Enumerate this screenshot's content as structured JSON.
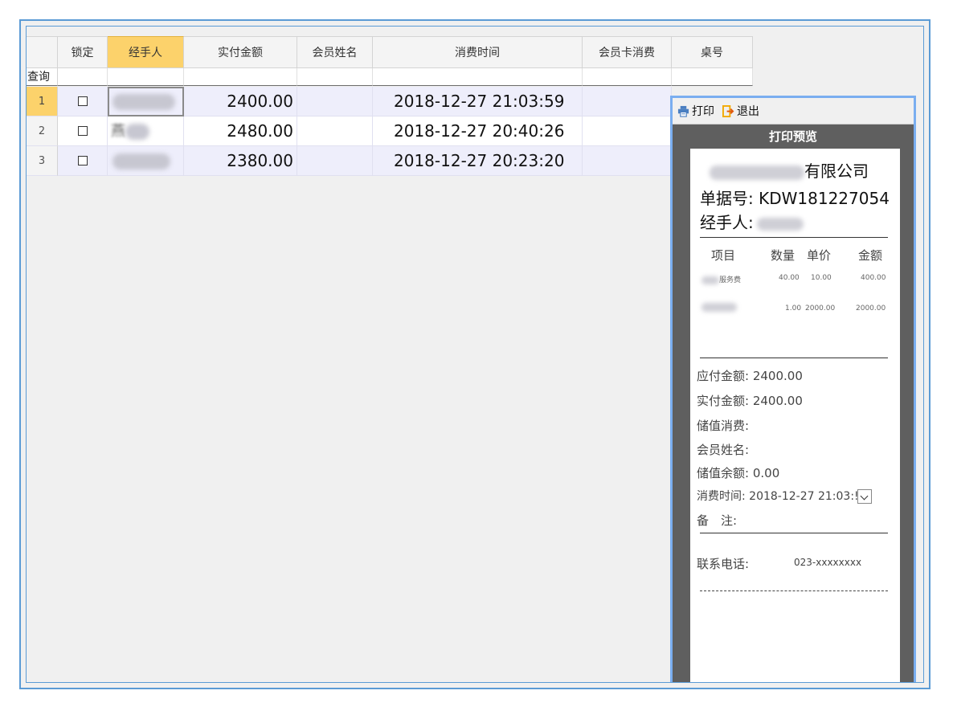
{
  "grid": {
    "columns": [
      {
        "key": "rownum",
        "label": ""
      },
      {
        "key": "lock",
        "label": "锁定"
      },
      {
        "key": "handler",
        "label": "经手人"
      },
      {
        "key": "paid",
        "label": "实付金额"
      },
      {
        "key": "member",
        "label": "会员姓名"
      },
      {
        "key": "time",
        "label": "消费时间"
      },
      {
        "key": "card",
        "label": "会员卡消费"
      },
      {
        "key": "table",
        "label": "桌号"
      }
    ],
    "query_label": "查询",
    "rows": [
      {
        "num": "1",
        "paid": "2400.00",
        "time": "2018-12-27 21:03:59"
      },
      {
        "num": "2",
        "paid": "2480.00",
        "time": "2018-12-27 20:40:26"
      },
      {
        "num": "3",
        "paid": "2380.00",
        "time": "2018-12-27 20:23:20"
      }
    ],
    "row2_handler_fragment": "燕"
  },
  "preview": {
    "toolbar": {
      "print": "打印",
      "exit": "退出"
    },
    "title": "打印预览",
    "company_suffix": "有限公司",
    "receipt_no_label": "单据号:",
    "receipt_no": "KDW181227054",
    "handler_label": "经手人:",
    "items_header": {
      "item": "项目",
      "qty": "数量",
      "price": "单价",
      "amount": "金额"
    },
    "items": [
      {
        "name_suffix": "服务费",
        "qty": "40.00",
        "price": "10.00",
        "amount": "400.00"
      },
      {
        "name_suffix": "",
        "qty": "1.00",
        "price": "2000.00",
        "amount": "2000.00"
      }
    ],
    "summary": {
      "payable_label": "应付金额:",
      "payable": "2400.00",
      "paid_label": "实付金额:",
      "paid": "2400.00",
      "stored_label": "储值消费:",
      "member_label": "会员姓名:",
      "balance_label": "储值余额:",
      "balance": "0.00",
      "time_label": "消费时间:",
      "time": "2018-12-27 21:03:!",
      "note_label": "备　注:"
    },
    "contact_label": "联系电话:",
    "contact": "023-xxxxxxxx"
  }
}
